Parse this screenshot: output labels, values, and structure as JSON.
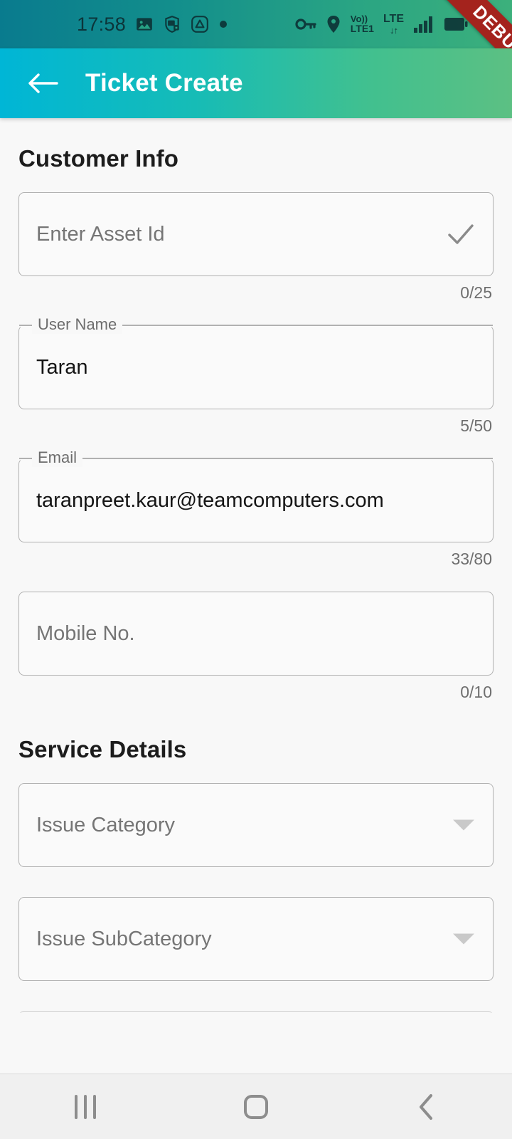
{
  "statusbar": {
    "time": "17:58",
    "left_icons": [
      "image-icon",
      "shield-lock-icon",
      "drive-triangle-icon",
      "dot-icon"
    ],
    "right_icons": [
      "key-icon",
      "location-pin-icon",
      "volte-icon",
      "lte-icon",
      "data-arrows-icon",
      "signal-bars-icon",
      "battery-icon"
    ],
    "volte_label_top": "Vo))",
    "volte_label_bottom": "LTE1",
    "lte_label": "LTE",
    "data_arrows": "↓↑"
  },
  "debug_ribbon": {
    "label": "DEBUG",
    "color": "#a4231d"
  },
  "appbar": {
    "title": "Ticket Create",
    "back_icon": "back-arrow-icon",
    "gradient_start": "#00b6d6",
    "gradient_end": "#5cc083"
  },
  "sections": {
    "customer_info": {
      "heading": "Customer Info",
      "fields": [
        {
          "name": "asset-id",
          "label": "",
          "placeholder": "Enter Asset Id",
          "value": "",
          "counter": "0/25",
          "trailing_icon": "check-icon",
          "floating_label": false
        },
        {
          "name": "user-name",
          "label": "User Name",
          "placeholder": "",
          "value": "Taran",
          "counter": "5/50",
          "trailing_icon": "",
          "floating_label": true
        },
        {
          "name": "email",
          "label": "Email",
          "placeholder": "",
          "value": "taranpreet.kaur@teamcomputers.com",
          "counter": "33/80",
          "trailing_icon": "",
          "floating_label": true
        },
        {
          "name": "mobile-no",
          "label": "",
          "placeholder": "Mobile No.",
          "value": "",
          "counter": "0/10",
          "trailing_icon": "",
          "floating_label": false
        }
      ]
    },
    "service_details": {
      "heading": "Service Details",
      "dropdowns": [
        {
          "name": "issue-category",
          "placeholder": "Issue Category",
          "value": "",
          "caret_icon": "chevron-down-icon"
        },
        {
          "name": "issue-subcategory",
          "placeholder": "Issue SubCategory",
          "value": "",
          "caret_icon": "chevron-down-icon"
        }
      ]
    }
  },
  "navbar": {
    "recents_icon": "recents-icon",
    "home_icon": "home-icon",
    "back_icon": "back-chevron-icon"
  }
}
